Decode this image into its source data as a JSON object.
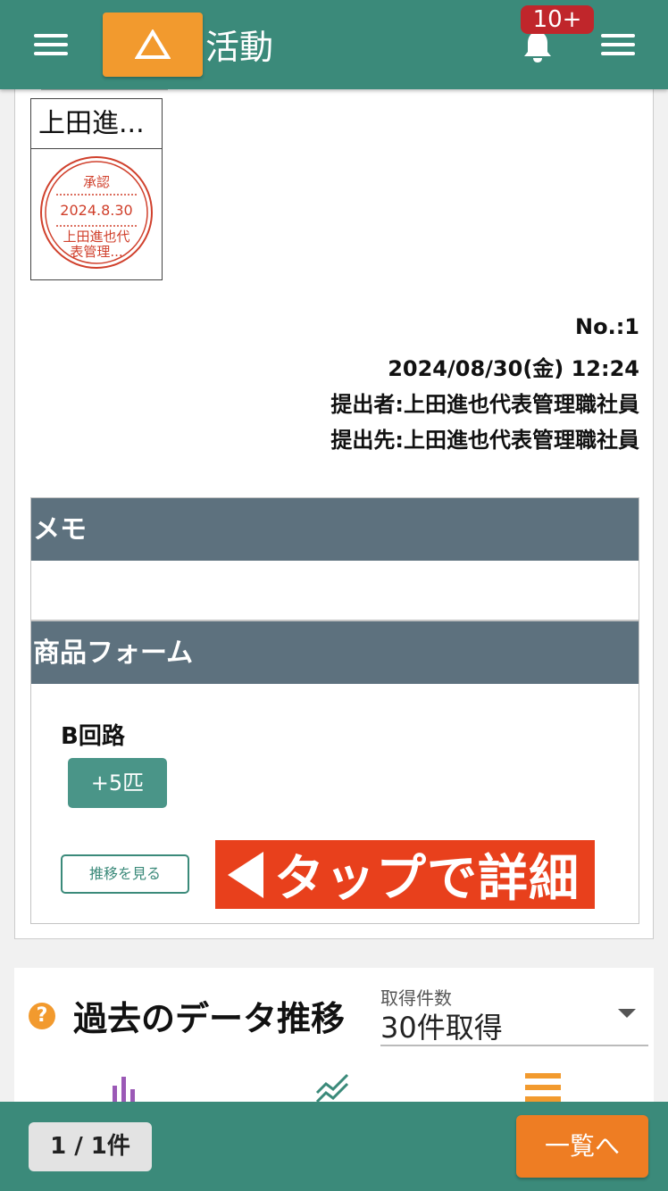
{
  "header": {
    "title": "活動",
    "notification_badge": "10+",
    "accent_color": "#3b8a7a",
    "logo_color": "#f29a2e"
  },
  "approval_stamp": {
    "name": "上田進...",
    "label": "承認",
    "date": "2024.8.30",
    "line1": "上田進也代",
    "line2": "表管理...",
    "stamp_color": "#d0402c"
  },
  "report_meta": {
    "number": "No.:1",
    "datetime": "2024/08/30(金) 12:24",
    "submitter": "提出者:上田進也代表管理職社員",
    "recipient": "提出先:上田進也代表管理職社員"
  },
  "memo_section": {
    "title": "メモ",
    "content": ""
  },
  "product_section": {
    "title": "商品フォーム",
    "item_label": "B回路",
    "item_value": "+5匹",
    "trend_button": "推移を見る",
    "tap_hint": "タップで詳細"
  },
  "past_data": {
    "title": "過去のデータ推移",
    "help_icon": "?",
    "select_label": "取得件数",
    "select_value": "30件取得",
    "views": [
      "bar-chart-icon",
      "line-chart-icon",
      "list-icon"
    ]
  },
  "footer": {
    "pager": "1 / 1件",
    "list_button": "一覧へ"
  }
}
